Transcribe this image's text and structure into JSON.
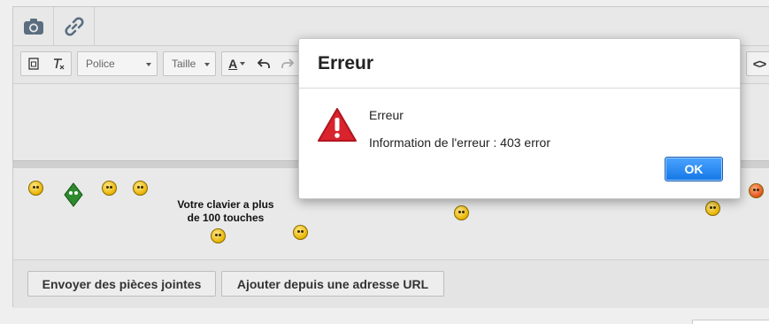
{
  "editor": {
    "topbar": {
      "camera_icon": "camera-icon",
      "link_icon": "link-icon"
    },
    "toolbar": {
      "font_dropdown": "Police",
      "size_dropdown": "Taille",
      "text_color_label": "A",
      "source_label": "<>"
    },
    "smileys": {
      "keyboard_text": "Votre clavier a plus de 100 touches"
    },
    "actions": {
      "attach_label": "Envoyer des pièces jointes",
      "url_label": "Ajouter depuis une adresse URL"
    }
  },
  "dialog": {
    "title": "Erreur",
    "message_title": "Erreur",
    "message_detail": "Information de l'erreur : 403 error",
    "ok_label": "OK",
    "icon": "warning-icon",
    "icon_color": "#d9232d",
    "ok_color": "#1577e6"
  }
}
